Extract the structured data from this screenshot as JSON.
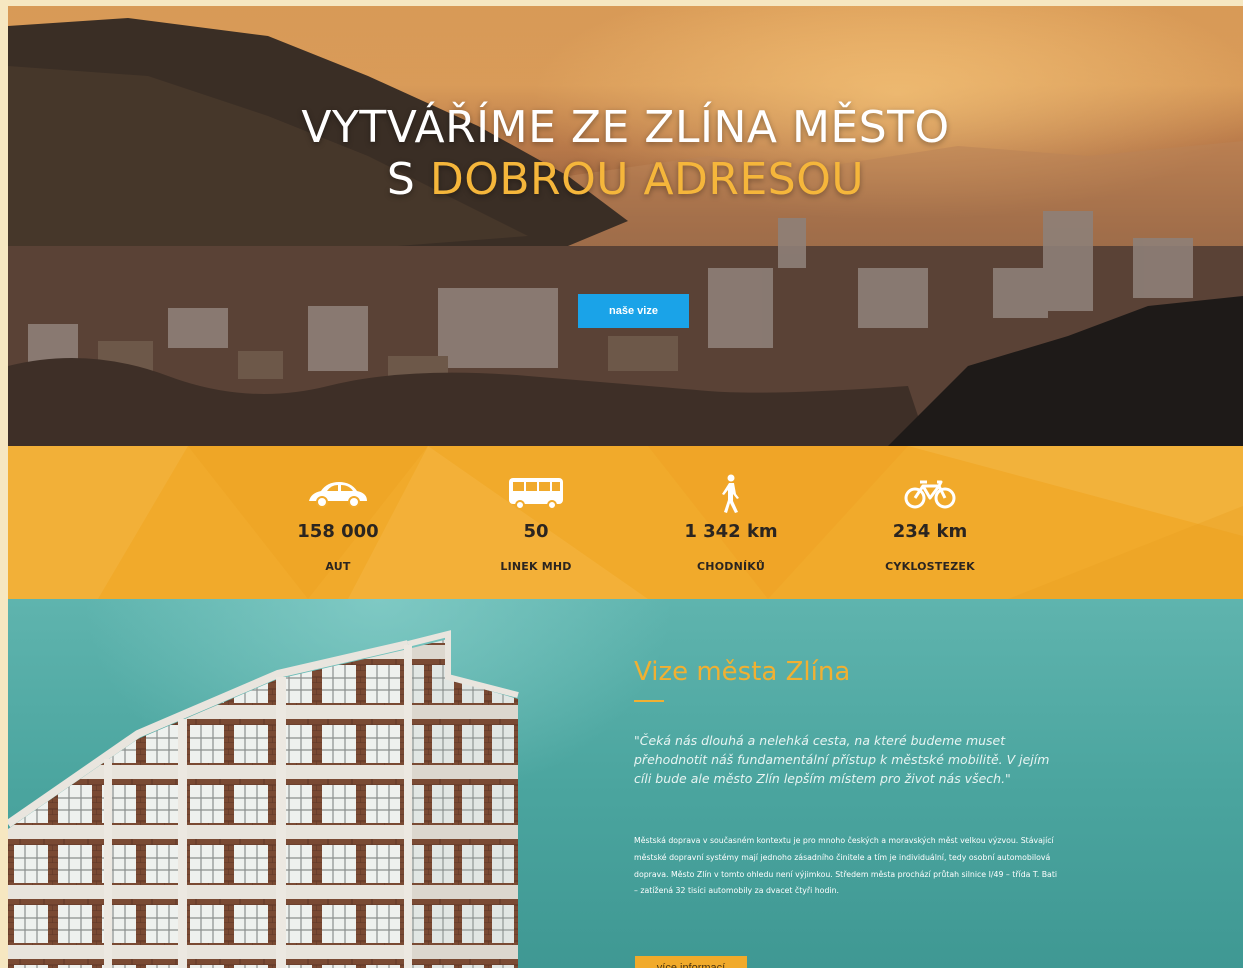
{
  "hero": {
    "title_line1": "VYTVÁŘÍME ZE ZLÍNA MĚSTO",
    "title_line2_prefix": "S ",
    "title_line2_highlight": "DOBROU ADRESOU",
    "cta_label": "naše vize"
  },
  "stats": [
    {
      "icon": "car-icon",
      "value": "158 000",
      "label": "AUT"
    },
    {
      "icon": "bus-icon",
      "value": "50",
      "label": "LINEK MHD"
    },
    {
      "icon": "pedestrian-icon",
      "value": "1 342 km",
      "label": "CHODNÍKŮ"
    },
    {
      "icon": "bicycle-icon",
      "value": "234 km",
      "label": "CYKLOSTEZEK"
    }
  ],
  "vision": {
    "title": "Vize města Zlína",
    "quote": "\"Čeká nás dlouhá a nelehká cesta, na které budeme muset přehodnotit náš fundamentální přístup k městské mobilitě. V jejím cíli bude ale město Zlín lepším místem pro život nás všech.\"",
    "body": "Městská doprava v současném kontextu je pro mnoho českých a moravských měst velkou výzvou. Stávající městské dopravní systémy mají jednoho zásadního činitele a tím je individuální, tedy osobní automobilová doprava. Město Zlín v tomto ohledu není výjimkou. Středem města prochází průtah silnice I/49 – třída T. Bati – zatížená 32 tisíci automobily za dvacet čtyři hodin.",
    "more_label": "více informací"
  },
  "colors": {
    "accent_yellow": "#f1aa2b",
    "cta_blue": "#1aa3e8",
    "teal": "#4ba59f"
  }
}
